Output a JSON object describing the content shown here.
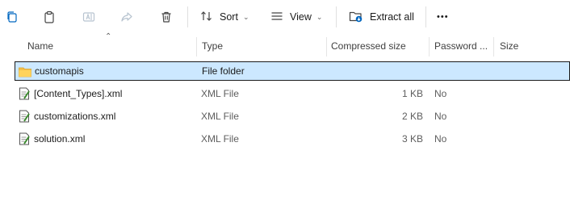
{
  "toolbar": {
    "sort_label": "Sort",
    "view_label": "View",
    "extract_label": "Extract all",
    "more_label": "•••"
  },
  "columns": {
    "name": "Name",
    "type": "Type",
    "compressed": "Compressed size",
    "password": "Password ...",
    "size": "Size"
  },
  "rows": [
    {
      "name": "customapis",
      "type": "File folder",
      "compressed": "",
      "password": "",
      "icon": "folder-icon"
    },
    {
      "name": "[Content_Types].xml",
      "type": "XML File",
      "compressed": "1 KB",
      "password": "No",
      "icon": "xml-file-icon"
    },
    {
      "name": "customizations.xml",
      "type": "XML File",
      "compressed": "2 KB",
      "password": "No",
      "icon": "xml-file-icon"
    },
    {
      "name": "solution.xml",
      "type": "XML File",
      "compressed": "3 KB",
      "password": "No",
      "icon": "xml-file-icon"
    }
  ],
  "colors": {
    "selection": "#cce8ff",
    "folder": "#f3c04a",
    "accent": "#0067c0"
  }
}
